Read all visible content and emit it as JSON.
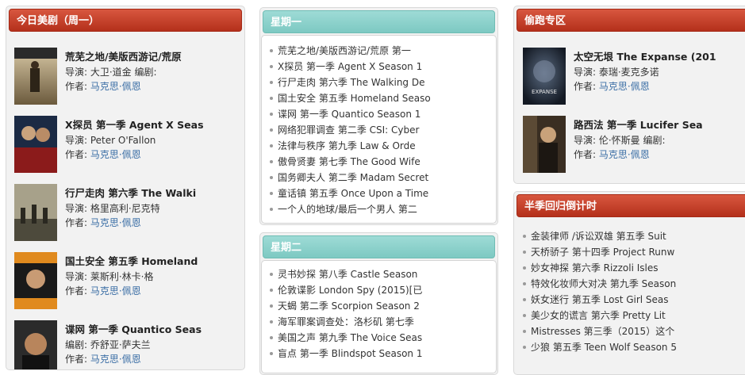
{
  "left_panel": {
    "title": "今日美剧（周一）",
    "shows": [
      {
        "title": "荒芜之地/美版西游记/荒原",
        "line1": "导演: 大卫·道金 编剧:",
        "author_label": "作者:",
        "author": "马克思·佩恩",
        "poster": "badlands-poster"
      },
      {
        "title": "X探员 第一季 Agent X Seas",
        "line1": "导演: Peter O'Fallon",
        "author_label": "作者:",
        "author": "马克思·佩恩",
        "poster": "agentx-poster"
      },
      {
        "title": "行尸走肉 第六季 The Walki",
        "line1": "导演: 格里高利·尼克特",
        "author_label": "作者:",
        "author": "马克思·佩恩",
        "poster": "walkingdead-poster"
      },
      {
        "title": "国土安全 第五季 Homeland",
        "line1": "导演: 莱斯利·林卡·格",
        "author_label": "作者:",
        "author": "马克思·佩恩",
        "poster": "homeland-poster"
      },
      {
        "title": "谍网 第一季 Quantico Seas",
        "line1": "编剧: 乔舒亚·萨夫兰",
        "author_label": "作者:",
        "author": "马克思·佩恩",
        "poster": "quantico-poster"
      }
    ]
  },
  "monday_panel": {
    "title": "星期一",
    "items": [
      "荒芜之地/美版西游记/荒原 第一",
      "X探员 第一季 Agent X Season 1",
      "行尸走肉 第六季 The Walking De",
      "国土安全 第五季 Homeland Seaso",
      "谍网 第一季 Quantico Season 1",
      "网络犯罪调查 第二季 CSI: Cyber",
      "法律与秩序 第九季 Law & Orde",
      "傲骨贤妻 第七季 The Good Wife",
      "国务卿夫人 第二季 Madam Secret",
      "童话镇 第五季 Once Upon a Time",
      "一个人的地球/最后一个男人 第二"
    ]
  },
  "tuesday_panel": {
    "title": "星期二",
    "items": [
      "灵书妙探 第八季 Castle Season",
      "伦敦谍影 London Spy (2015)[已",
      "天蝎 第二季 Scorpion Season 2",
      "海军罪案调查处：洛杉矶 第七季",
      "美国之声 第九季 The Voice Seas",
      "盲点 第一季 Blindspot Season 1"
    ]
  },
  "right_panel": {
    "title": "偷跑专区",
    "shows": [
      {
        "title": "太空无垠 The Expanse (201",
        "line1": "导演: 泰瑞·麦克多诺",
        "author_label": "作者:",
        "author": "马克思·佩恩",
        "poster": "expanse-poster",
        "poster_text": "EXPANSE"
      },
      {
        "title": "路西法 第一季 Lucifer Sea",
        "line1": "导演: 伦·怀斯曼 编剧:",
        "author_label": "作者:",
        "author": "马克思·佩恩",
        "poster": "lucifer-poster"
      }
    ]
  },
  "countdown_panel": {
    "title": "半季回归倒计时",
    "items": [
      "金装律师 /诉讼双雄 第五季 Suit",
      "天桥骄子 第十四季 Project Runw",
      "妙女神探 第六季 Rizzoli Isles",
      "特效化妆师大对决 第九季 Season",
      "妖女迷行 第五季 Lost Girl Seas",
      "美少女的谎言 第六季 Pretty Lit",
      "Mistresses 第三季（2015）这个",
      "少狼 第五季 Teen Wolf Season 5"
    ]
  },
  "colors": {
    "red_header": "#c4402a",
    "teal_header": "#8dd2cb",
    "link": "#3b6ea5"
  }
}
